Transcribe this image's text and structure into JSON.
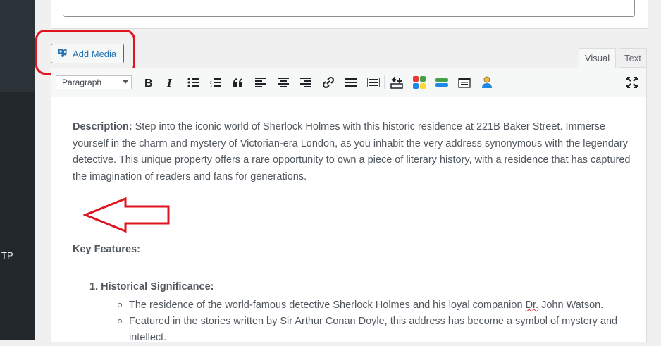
{
  "sidebar": {
    "partial_label": "TP"
  },
  "add_media": {
    "label": "Add Media"
  },
  "tabs": [
    {
      "label": "Visual"
    },
    {
      "label": "Text"
    }
  ],
  "toolbar": {
    "format_select": "Paragraph",
    "buttons": [
      "bold",
      "italic",
      "bulleted-list",
      "numbered-list",
      "blockquote",
      "align-left",
      "align-center",
      "align-right",
      "insert-link",
      "read-more",
      "toolbar-toggle",
      "upload",
      "colors",
      "divider",
      "calendar",
      "user",
      "fullscreen"
    ]
  },
  "content": {
    "description_label": "Description:",
    "description_text": " Step into the iconic world of Sherlock Holmes with this historic residence at 221B Baker Street. Immerse yourself in the charm and mystery of Victorian-era London, as you inhabit the very address synonymous with the legendary detective. This unique property offers a rare opportunity to own a piece of literary history, with a residence that has captured the imagination of readers and fans for generations.",
    "key_features": "Key Features:",
    "list_item_1": "1. Historical Significance:",
    "sub_item_1_before": "The residence of the world-famous detective Sherlock Holmes and his loyal companion ",
    "sub_item_1_spell": "Dr.",
    "sub_item_1_after": " John Watson.",
    "sub_item_2": "Featured in the stories written by Sir Arthur Conan Doyle, this address has become a symbol of mystery and intellect."
  },
  "colors": {
    "highlight": "#e0141e",
    "accent": "#2271b1"
  }
}
